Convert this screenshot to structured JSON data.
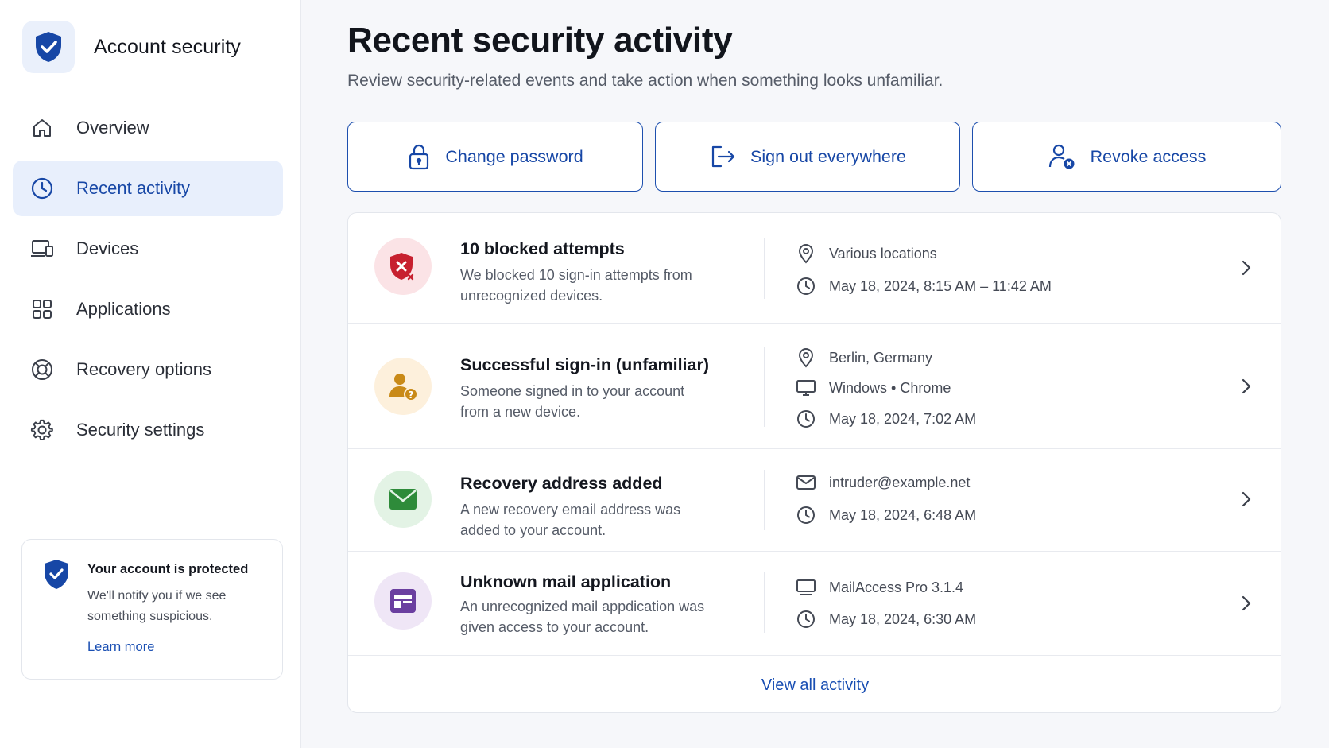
{
  "brand": {
    "title": "Account security"
  },
  "colors": {
    "accent": "#1747a6",
    "danger": "#c7202f",
    "warning": "#c98a18",
    "success": "#2e8b3a",
    "purple": "#6b3fa0"
  },
  "nav": {
    "items": [
      {
        "label": "Overview",
        "icon": "home-icon",
        "active": false
      },
      {
        "label": "Recent activity",
        "icon": "clock-icon",
        "active": true
      },
      {
        "label": "Devices",
        "icon": "devices-icon",
        "active": false
      },
      {
        "label": "Applications",
        "icon": "grid-icon",
        "active": false
      },
      {
        "label": "Recovery options",
        "icon": "lifebuoy-icon",
        "active": false
      },
      {
        "label": "Security settings",
        "icon": "gear-icon",
        "active": false
      }
    ]
  },
  "protect": {
    "title": "Your account is protected",
    "body": "We'll notify you if we see something suspicious.",
    "link": "Learn more"
  },
  "header": {
    "title": "Recent security activity",
    "subtitle": "Review security-related events and take action when something looks unfamiliar."
  },
  "actions": [
    {
      "label": "Change password",
      "icon": "lock-icon"
    },
    {
      "label": "Sign out everywhere",
      "icon": "sign-out-icon"
    },
    {
      "label": "Revoke access",
      "icon": "user-remove-icon"
    }
  ],
  "events": [
    {
      "title": "10 blocked attempts",
      "description": "We blocked 10 sign-in attempts from unrecognized devices.",
      "icon": "shield-blocked-icon",
      "meta": [
        {
          "icon": "location-icon",
          "text": "Various locations"
        },
        {
          "icon": "clock-icon",
          "text": "May 18, 2024, 8:15 AM – 11:42 AM"
        }
      ]
    },
    {
      "title": "Successful sign-in (unfamiliar)",
      "description": "Someone signed in to your account from a new device.",
      "icon": "user-question-icon",
      "meta": [
        {
          "icon": "location-icon",
          "text": "Berlin, Germany"
        },
        {
          "icon": "monitor-icon",
          "text": "Windows • Chrome"
        },
        {
          "icon": "clock-icon",
          "text": "May 18, 2024, 7:02 AM"
        }
      ]
    },
    {
      "title": "Recovery address added",
      "description": "A new recovery email address was added to your account.",
      "icon": "envelope-icon",
      "meta": [
        {
          "icon": "mail-icon",
          "text": "intruder@example.net"
        },
        {
          "icon": "clock-icon",
          "text": "May 18, 2024, 6:48 AM"
        }
      ]
    },
    {
      "title": "Unknown mail application",
      "description": "An unrecognized mail appdication was given access to your account.",
      "icon": "app-icon",
      "meta": [
        {
          "icon": "monitor-icon",
          "text": "MailAccess Pro 3.1.4"
        },
        {
          "icon": "clock-icon",
          "text": "May 18, 2024, 6:30 AM"
        }
      ]
    }
  ],
  "footer": {
    "view_all": "View all activity"
  }
}
